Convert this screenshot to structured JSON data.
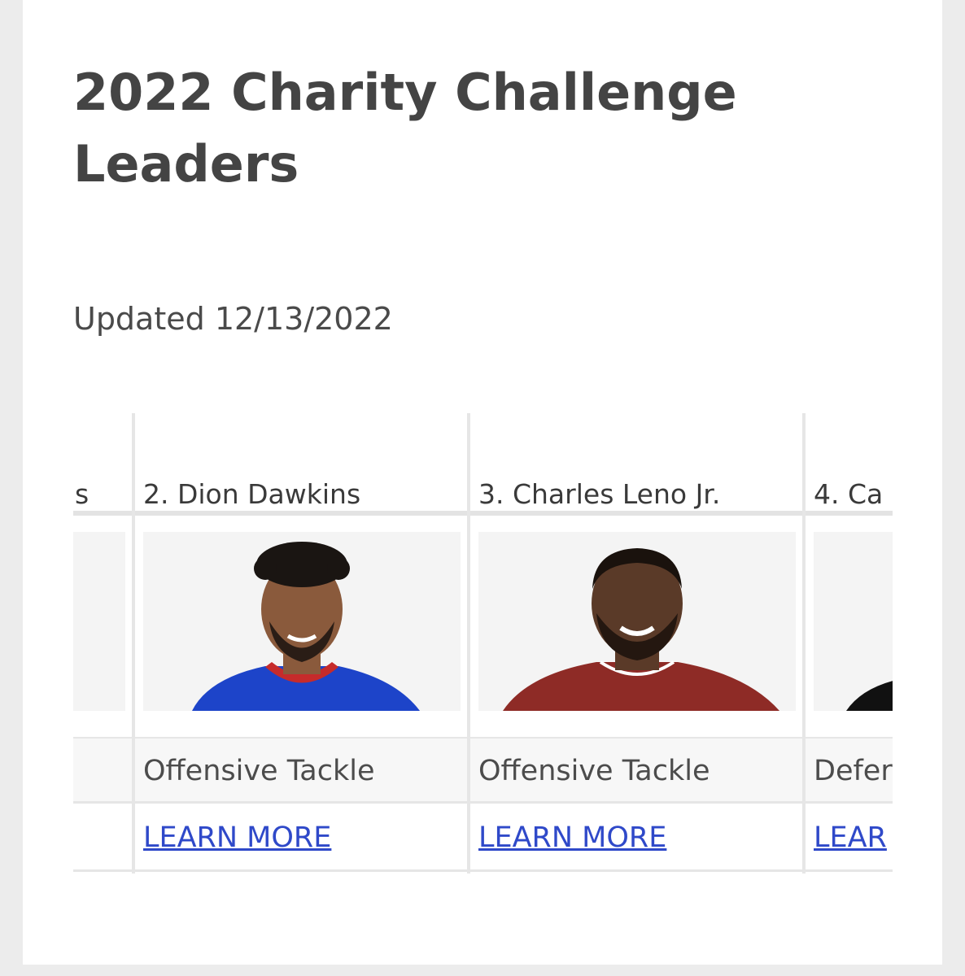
{
  "article": {
    "title": "2022 Charity Challenge Leaders",
    "updated": "Updated 12/13/2022"
  },
  "leaders": [
    {
      "name": "",
      "position": "",
      "link": ""
    },
    {
      "name": "2. Dion Dawkins",
      "position": "Offensive Tackle",
      "link": "LEARN MORE",
      "jersey_color": "#1d44c9",
      "skin_color": "#8a5a3c"
    },
    {
      "name": "3. Charles Leno Jr.",
      "position": "Offensive Tackle",
      "link": "LEARN MORE",
      "jersey_color": "#8e2b26",
      "skin_color": "#5a3a28"
    },
    {
      "name": "4. Ca",
      "position": "Defer",
      "link": "LEAR",
      "jersey_color": "#111111"
    }
  ],
  "colors": {
    "link": "#2f49c9",
    "title": "#444444",
    "background": "#ececec"
  }
}
